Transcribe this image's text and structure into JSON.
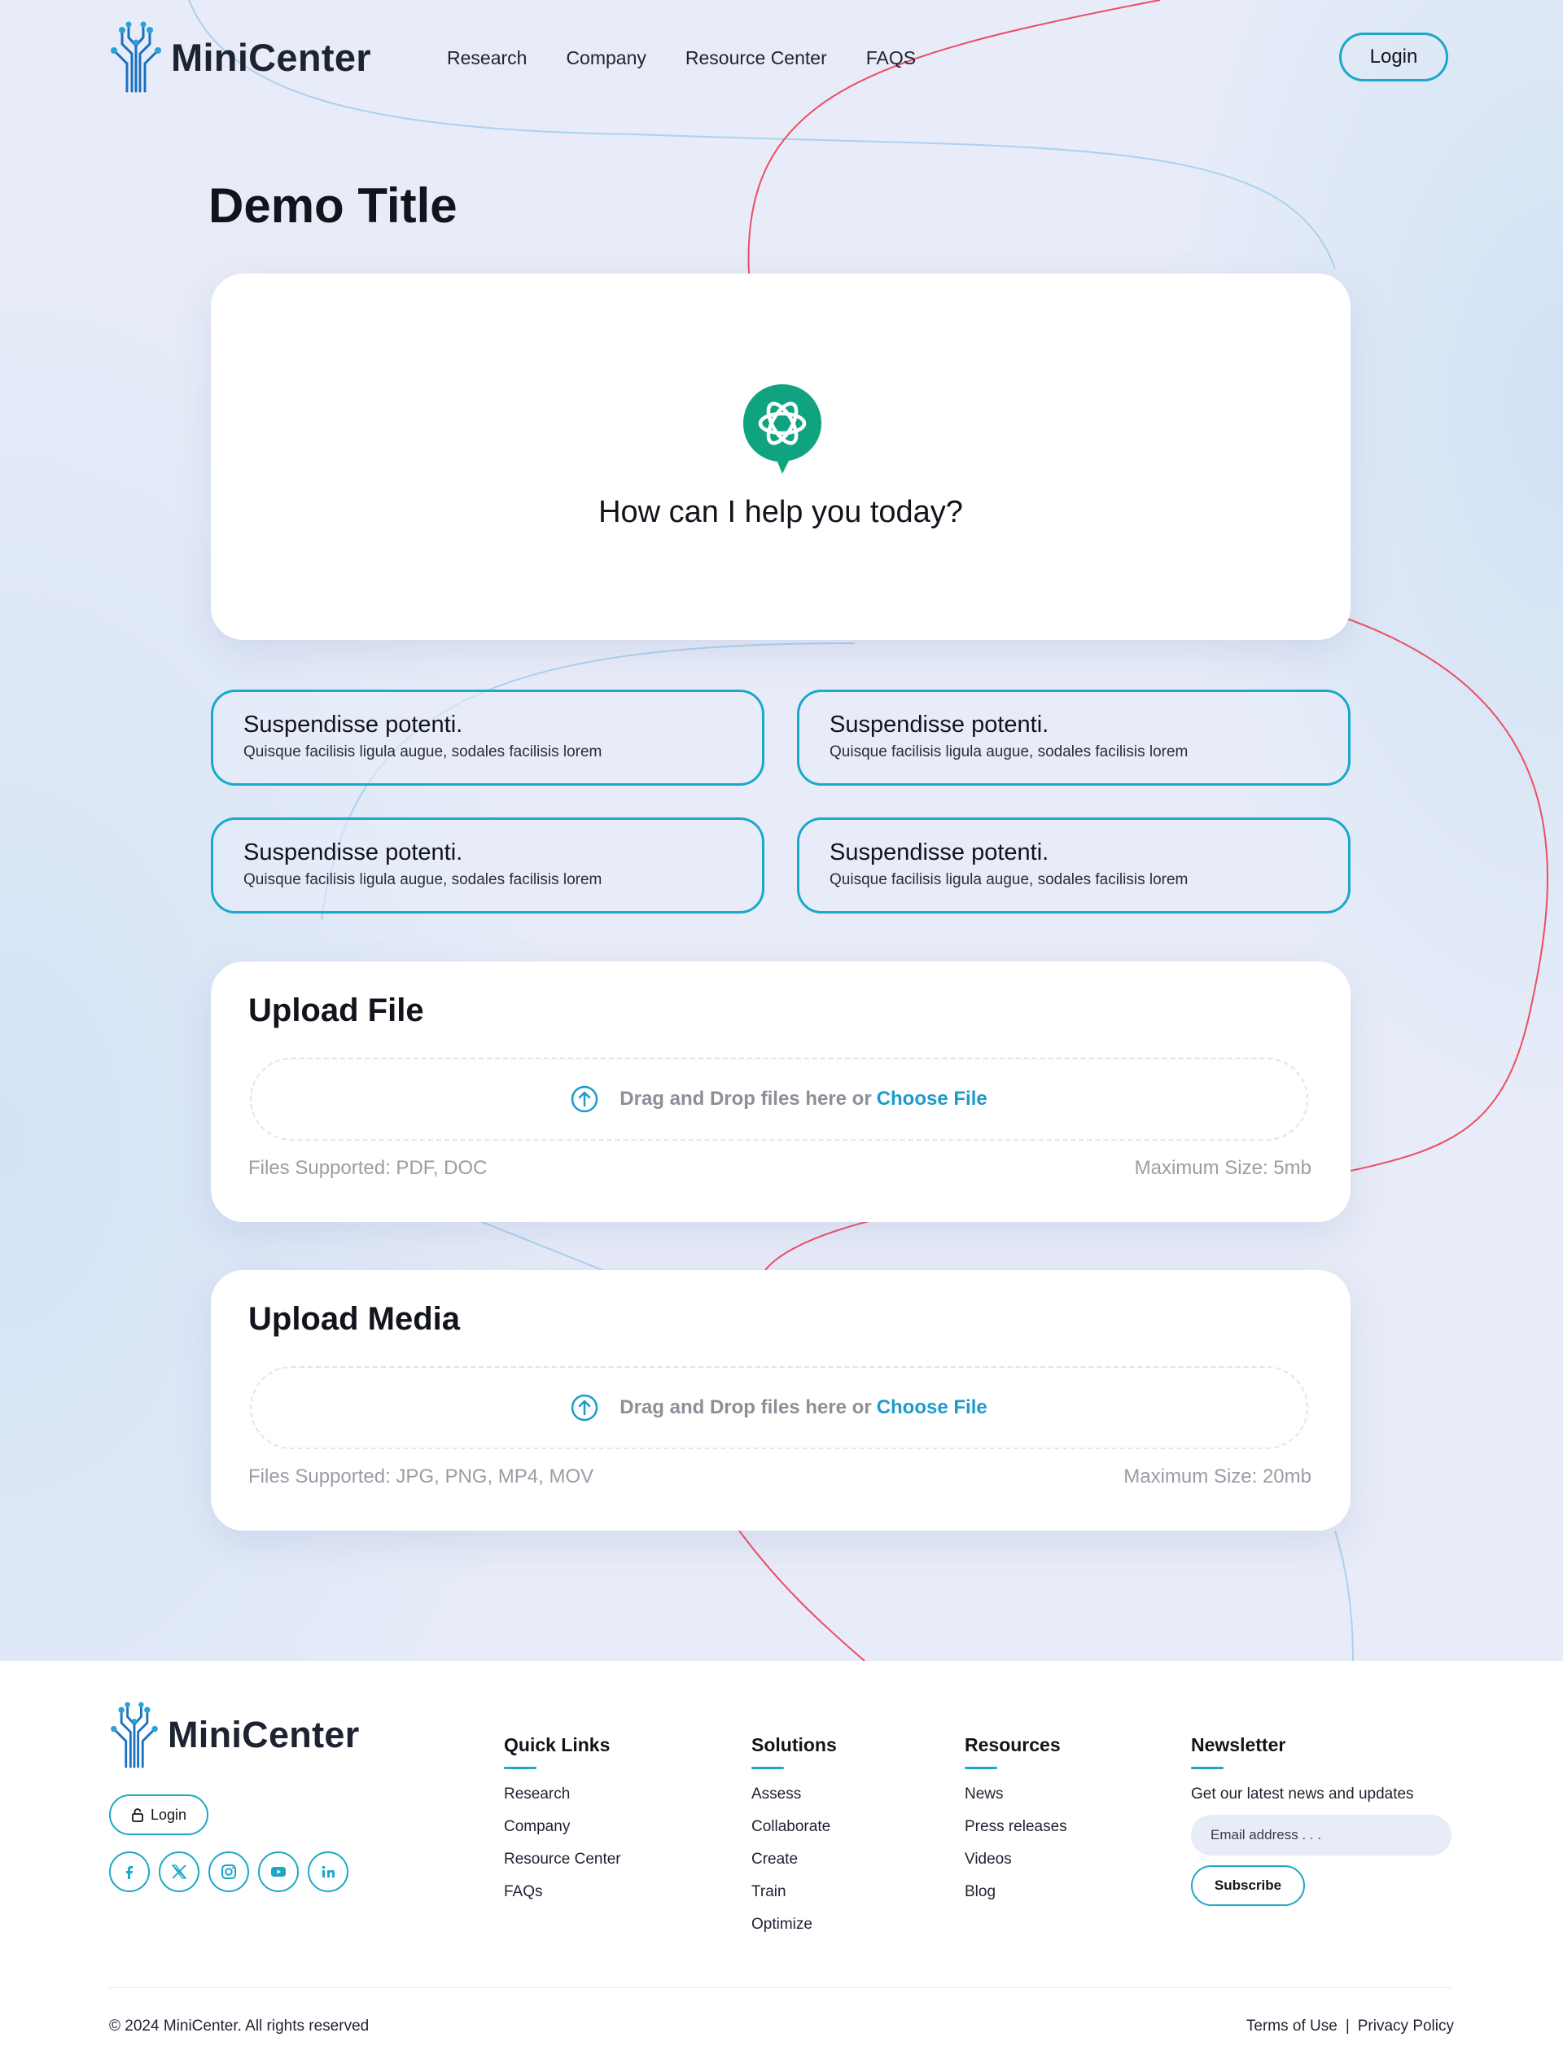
{
  "brand": {
    "name": "MiniCenter",
    "accent": "#1ca7c8",
    "curve_red": "#ec4d64",
    "curve_blue": "#a9d2ee"
  },
  "nav": {
    "items": [
      "Research",
      "Company",
      "Resource Center",
      "FAQS"
    ],
    "login_label": "Login"
  },
  "main": {
    "title": "Demo Title",
    "hero": {
      "prompt": "How can I help you today?",
      "icon": "openai-chat-icon"
    },
    "suggestions": [
      {
        "title": "Suspendisse potenti.",
        "subtitle": "Quisque facilisis ligula augue, sodales facilisis lorem"
      },
      {
        "title": "Suspendisse potenti.",
        "subtitle": "Quisque facilisis ligula augue, sodales facilisis lorem"
      },
      {
        "title": "Suspendisse potenti.",
        "subtitle": "Quisque facilisis ligula augue, sodales facilisis lorem"
      },
      {
        "title": "Suspendisse potenti.",
        "subtitle": "Quisque facilisis ligula augue, sodales facilisis lorem"
      }
    ],
    "upload_file": {
      "title": "Upload File",
      "drop_text": "Drag and Drop files here or",
      "choose_label": "Choose File",
      "supported": "Files Supported: PDF, DOC",
      "max_size": "Maximum Size: 5mb"
    },
    "upload_media": {
      "title": "Upload Media",
      "drop_text": "Drag and Drop files here or",
      "choose_label": "Choose File",
      "supported": "Files Supported: JPG, PNG, MP4, MOV",
      "max_size": "Maximum Size: 20mb"
    }
  },
  "footer": {
    "login_label": "Login",
    "socials": [
      "facebook-icon",
      "x-icon",
      "instagram-icon",
      "youtube-icon",
      "linkedin-icon"
    ],
    "quick_links": {
      "title": "Quick Links",
      "items": [
        "Research",
        "Company",
        "Resource Center",
        "FAQs"
      ]
    },
    "solutions": {
      "title": "Solutions",
      "items": [
        "Assess",
        "Collaborate",
        "Create",
        "Train",
        "Optimize"
      ]
    },
    "resources": {
      "title": "Resources",
      "items": [
        "News",
        "Press releases",
        "Videos",
        "Blog"
      ]
    },
    "newsletter": {
      "title": "Newsletter",
      "text": "Get our latest news and updates",
      "email_placeholder": "Email address . . .",
      "subscribe_label": "Subscribe"
    },
    "copyright": "© 2024 MiniCenter. All rights reserved",
    "terms": "Terms of Use",
    "separator": "|",
    "privacy": "Privacy Policy"
  }
}
